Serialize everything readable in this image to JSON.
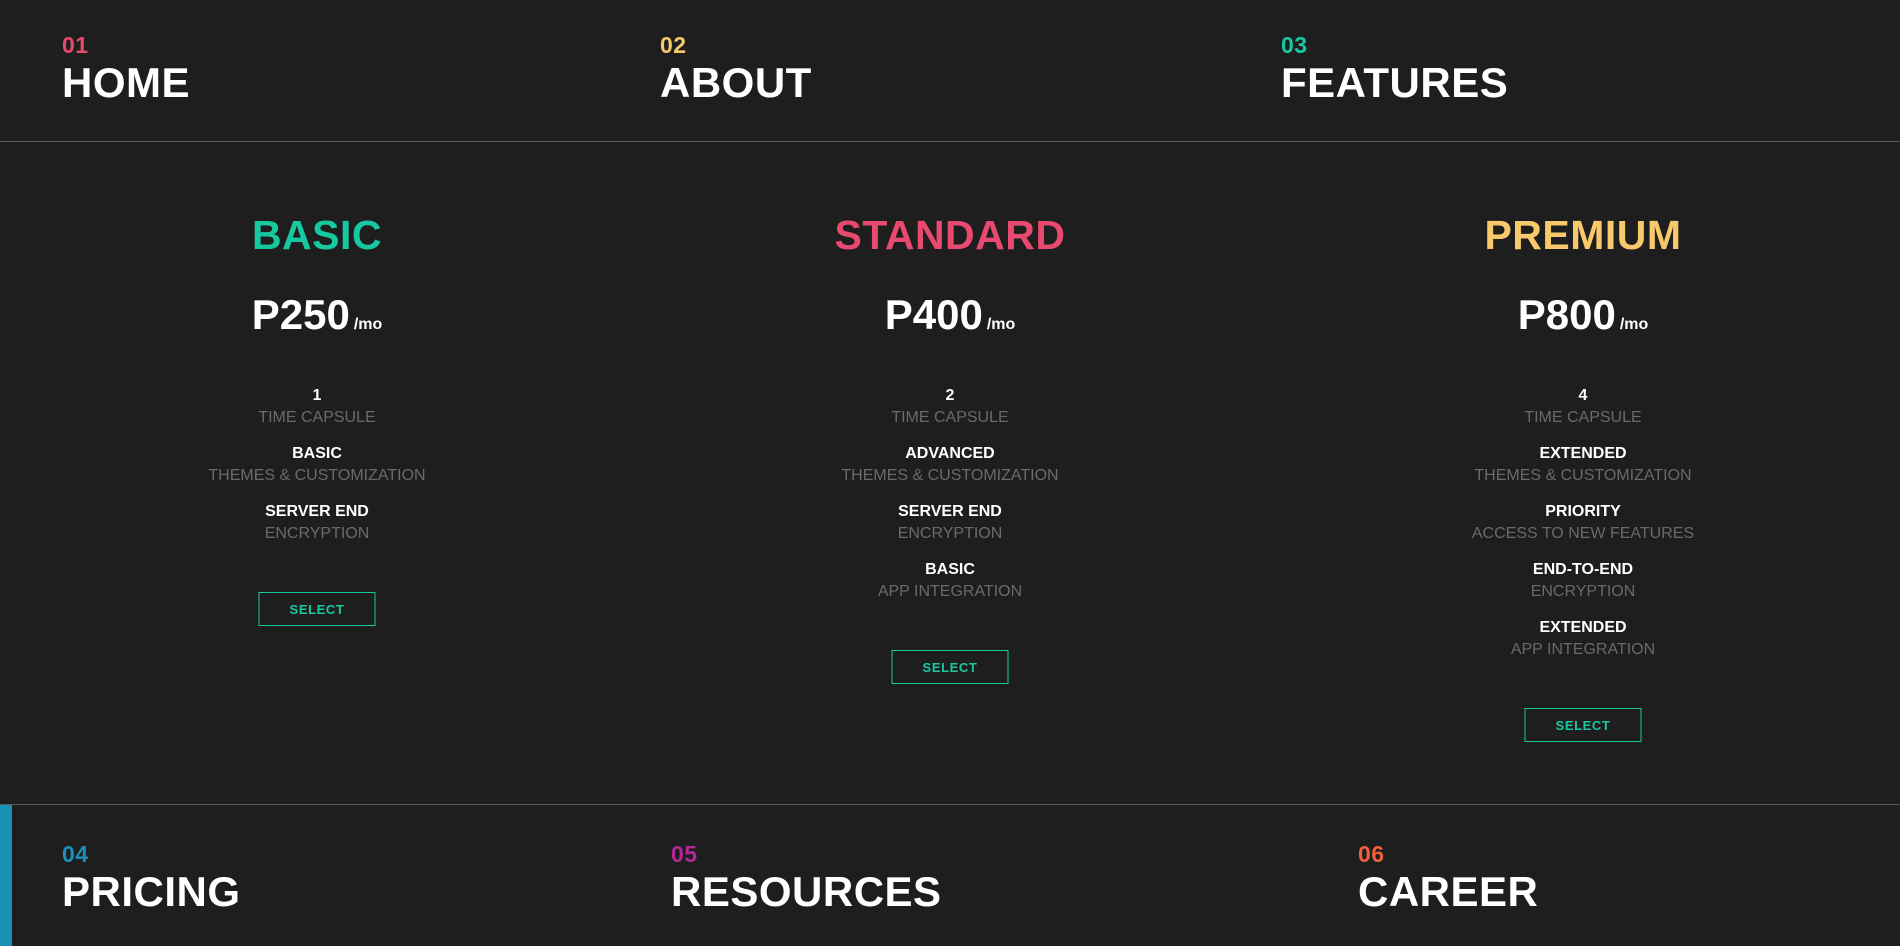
{
  "nav_top": [
    {
      "num": "01",
      "label": "HOME",
      "color": "#e8496e"
    },
    {
      "num": "02",
      "label": "ABOUT",
      "color": "#f7c96a"
    },
    {
      "num": "03",
      "label": "FEATURES",
      "color": "#17c9a0"
    }
  ],
  "nav_bottom": [
    {
      "num": "04",
      "label": "PRICING",
      "color": "#1a8fb8"
    },
    {
      "num": "05",
      "label": "RESOURCES",
      "color": "#b5289a"
    },
    {
      "num": "06",
      "label": "CAREER",
      "color": "#f0603c"
    }
  ],
  "active_accent": "#1a8fb8",
  "plans": [
    {
      "name": "BASIC",
      "color": "#17c9a0",
      "price": "P250",
      "unit": "/mo",
      "features": [
        {
          "value": "1",
          "desc": "TIME CAPSULE"
        },
        {
          "value": "BASIC",
          "desc": "THEMES & CUSTOMIZATION"
        },
        {
          "value": "SERVER END",
          "desc": "ENCRYPTION"
        }
      ],
      "button": "SELECT"
    },
    {
      "name": "STANDARD",
      "color": "#e8496e",
      "price": "P400",
      "unit": "/mo",
      "features": [
        {
          "value": "2",
          "desc": "TIME CAPSULE"
        },
        {
          "value": "ADVANCED",
          "desc": "THEMES & CUSTOMIZATION"
        },
        {
          "value": "SERVER END",
          "desc": "ENCRYPTION"
        },
        {
          "value": "BASIC",
          "desc": "APP INTEGRATION"
        }
      ],
      "button": "SELECT"
    },
    {
      "name": "PREMIUM",
      "color": "#f7c96a",
      "price": "P800",
      "unit": "/mo",
      "features": [
        {
          "value": "4",
          "desc": "TIME CAPSULE"
        },
        {
          "value": "EXTENDED",
          "desc": "THEMES & CUSTOMIZATION"
        },
        {
          "value": "PRIORITY",
          "desc": "ACCESS TO NEW FEATURES"
        },
        {
          "value": "END-TO-END",
          "desc": "ENCRYPTION"
        },
        {
          "value": "EXTENDED",
          "desc": "APP INTEGRATION"
        }
      ],
      "button": "SELECT"
    }
  ]
}
